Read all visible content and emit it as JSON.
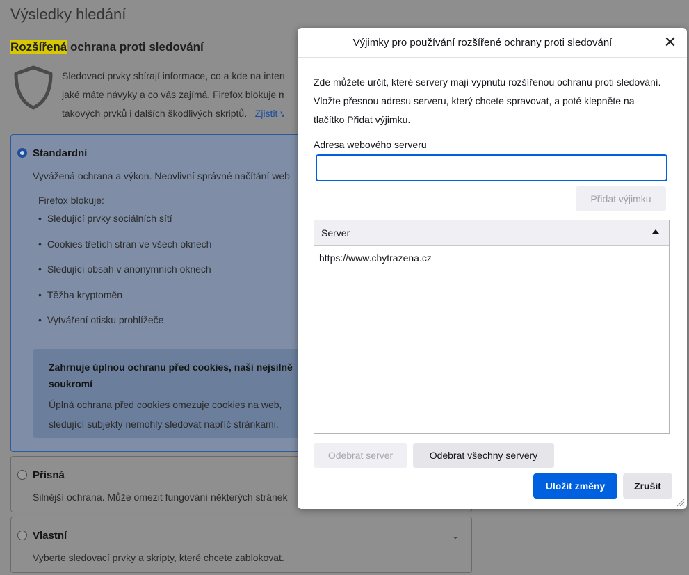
{
  "page": {
    "title": "Výsledky hledání",
    "section_title_highlight": "Rozšířená",
    "section_title_rest": " ochrana proti sledování",
    "etp_description_lines": [
      "Sledovací prvky sbírají informace, co a kde na intern",
      "jaké máte návyky a co vás zajímá. Firefox blokuje m",
      "takových prvků i dalších škodlivých skriptů."
    ],
    "learn_more": "Zjistit v"
  },
  "standard": {
    "title": "Standardní",
    "description": "Vyvážená ochrana a výkon. Neovlivní správné načítání web",
    "blocks_label": "Firefox blokuje:",
    "blocks": [
      "Sledující prvky sociálních sítí",
      "Cookies třetích stran ve všech oknech",
      "Sledující obsah v anonymních oknech",
      "Těžba kryptoměn",
      "Vytváření otisku prohlížeče"
    ],
    "info_title": "Zahrnuje úplnou ochranu před cookies, naši nejsilně soukromí",
    "info_text": "Úplná ochrana před cookies omezuje cookies na web, sledující subjekty nemohly sledovat napříč stránkami."
  },
  "strict": {
    "title": "Přísná",
    "description": "Silnější ochrana. Může omezit fungování některých stránek"
  },
  "custom": {
    "title": "Vlastní",
    "description": "Vyberte sledovací prvky a skripty, které chcete zablokovat."
  },
  "dialog": {
    "title": "Výjimky pro používání rozšířené ochrany proti sledování",
    "intro": "Zde můžete určit, které servery mají vypnutu rozšířenou ochranu proti sledování. Vložte přesnou adresu serveru, který chcete spravovat, a poté klepněte na tlačítko Přidat výjimku.",
    "address_label": "Adresa webového serveru",
    "address_value": "",
    "add_button": "Přidat výjimku",
    "column_header": "Server",
    "servers": [
      "https://www.chytrazena.cz"
    ],
    "remove_button": "Odebrat server",
    "remove_all_button": "Odebrat všechny servery",
    "save_button": "Uložit změny",
    "cancel_button": "Zrušit"
  },
  "icons": {
    "shield": "shield-icon",
    "close": "close-icon",
    "sort": "sort-ascending-icon",
    "chevron": "chevron-down-icon",
    "resize": "resize-grip-icon"
  },
  "colors": {
    "accent": "#0061e0",
    "overlay": "#8e8e8e"
  }
}
